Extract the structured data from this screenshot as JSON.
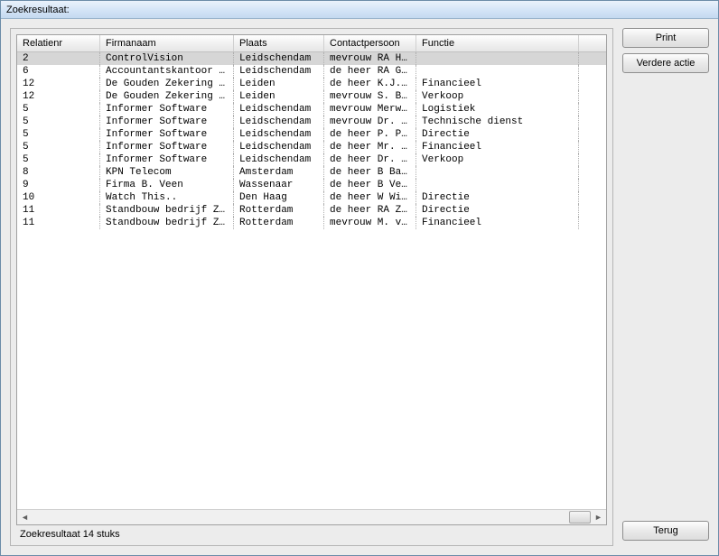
{
  "window": {
    "title": "Zoekresultaat:"
  },
  "buttons": {
    "print": "Print",
    "verdere_actie": "Verdere actie",
    "terug": "Terug"
  },
  "table": {
    "columns": [
      "Relatienr",
      "Firmanaam",
      "Plaats",
      "Contactpersoon",
      "Functie"
    ],
    "rows": [
      {
        "selected": true,
        "cells": [
          "2",
          "ControlVision",
          "Leidschendam",
          "mevrouw RA H...",
          ""
        ]
      },
      {
        "selected": false,
        "cells": [
          "6",
          "Accountantskantoor FBS",
          "Leidschendam",
          "de heer RA G...",
          ""
        ]
      },
      {
        "selected": false,
        "cells": [
          "12",
          "De Gouden Zekering C...",
          "Leiden",
          "de heer K.J....",
          "Financieel"
        ]
      },
      {
        "selected": false,
        "cells": [
          "12",
          "De Gouden Zekering C...",
          "Leiden",
          "mevrouw S. B...",
          "Verkoop"
        ]
      },
      {
        "selected": false,
        "cells": [
          "5",
          "Informer Software",
          "Leidschendam",
          "mevrouw Merwede",
          "Logistiek"
        ]
      },
      {
        "selected": false,
        "cells": [
          "5",
          "Informer Software",
          "Leidschendam",
          "mevrouw Dr. ...",
          "Technische dienst"
        ]
      },
      {
        "selected": false,
        "cells": [
          "5",
          "Informer Software",
          "Leidschendam",
          "de heer P. P...",
          "Directie"
        ]
      },
      {
        "selected": false,
        "cells": [
          "5",
          "Informer Software",
          "Leidschendam",
          "de heer Mr. ...",
          "Financieel"
        ]
      },
      {
        "selected": false,
        "cells": [
          "5",
          "Informer Software",
          "Leidschendam",
          "de heer Dr. ...",
          "Verkoop"
        ]
      },
      {
        "selected": false,
        "cells": [
          "8",
          "KPN Telecom",
          "Amsterdam",
          "de heer B Ba...",
          ""
        ]
      },
      {
        "selected": false,
        "cells": [
          "9",
          "Firma B. Veen",
          "Wassenaar",
          "de heer B Veen",
          ""
        ]
      },
      {
        "selected": false,
        "cells": [
          "10",
          "Watch This..",
          "Den Haag",
          "de heer W Wi...",
          "Directie"
        ]
      },
      {
        "selected": false,
        "cells": [
          "11",
          "Standbouw bedrijf Za...",
          "Rotterdam",
          "de heer RA Z...",
          "Directie"
        ]
      },
      {
        "selected": false,
        "cells": [
          "11",
          "Standbouw bedrijf Za...",
          "Rotterdam",
          "mevrouw M. v...",
          "Financieel"
        ]
      }
    ]
  },
  "status": "Zoekresultaat 14 stuks"
}
